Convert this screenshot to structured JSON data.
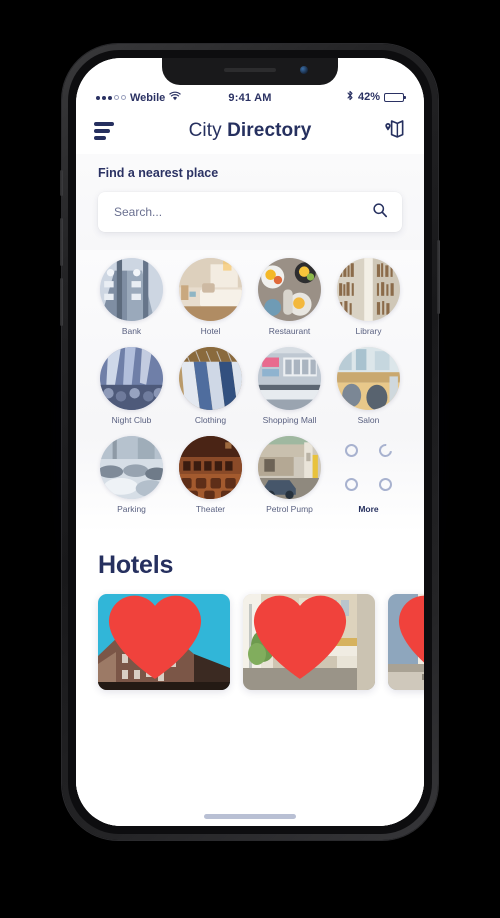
{
  "status_bar": {
    "carrier": "Webile",
    "signal_dots_filled": 3,
    "signal_dots_hollow": 2,
    "wifi_icon": "wifi-icon",
    "time": "9:41 AM",
    "bluetooth_icon": "bluetooth-icon",
    "battery_percent": "42%",
    "battery_level": 42
  },
  "navbar": {
    "menu_icon": "hamburger-menu-icon",
    "title_light": "City ",
    "title_bold": "Directory",
    "map_icon": "map-location-icon"
  },
  "search": {
    "label": "Find a nearest place",
    "placeholder": "Search...",
    "value": "",
    "icon": "search-icon"
  },
  "categories": [
    {
      "label": "Bank",
      "icon": "bank-photo"
    },
    {
      "label": "Hotel",
      "icon": "hotel-photo"
    },
    {
      "label": "Restaurant",
      "icon": "restaurant-photo"
    },
    {
      "label": "Library",
      "icon": "library-photo"
    },
    {
      "label": "Night Club",
      "icon": "nightclub-photo"
    },
    {
      "label": "Clothing",
      "icon": "clothing-photo"
    },
    {
      "label": "Shopping Mall",
      "icon": "mall-photo"
    },
    {
      "label": "Salon",
      "icon": "salon-photo"
    },
    {
      "label": "Parking",
      "icon": "parking-photo"
    },
    {
      "label": "Theater",
      "icon": "theater-photo"
    },
    {
      "label": "Petrol Pump",
      "icon": "petrol-photo"
    },
    {
      "label": "More",
      "icon": "more-grid-icon"
    }
  ],
  "hotels": {
    "title": "Hotels",
    "cards": [
      {
        "name": "hotel-card-1",
        "favorite_icon": "heart-icon"
      },
      {
        "name": "hotel-card-2",
        "favorite_icon": "heart-icon"
      },
      {
        "name": "hotel-card-3",
        "favorite_icon": "heart-icon"
      }
    ]
  },
  "colors": {
    "navy": "#26305f",
    "muted": "#5a6181",
    "heart": "#f0423c",
    "more_ring": "#a8b2cf"
  }
}
